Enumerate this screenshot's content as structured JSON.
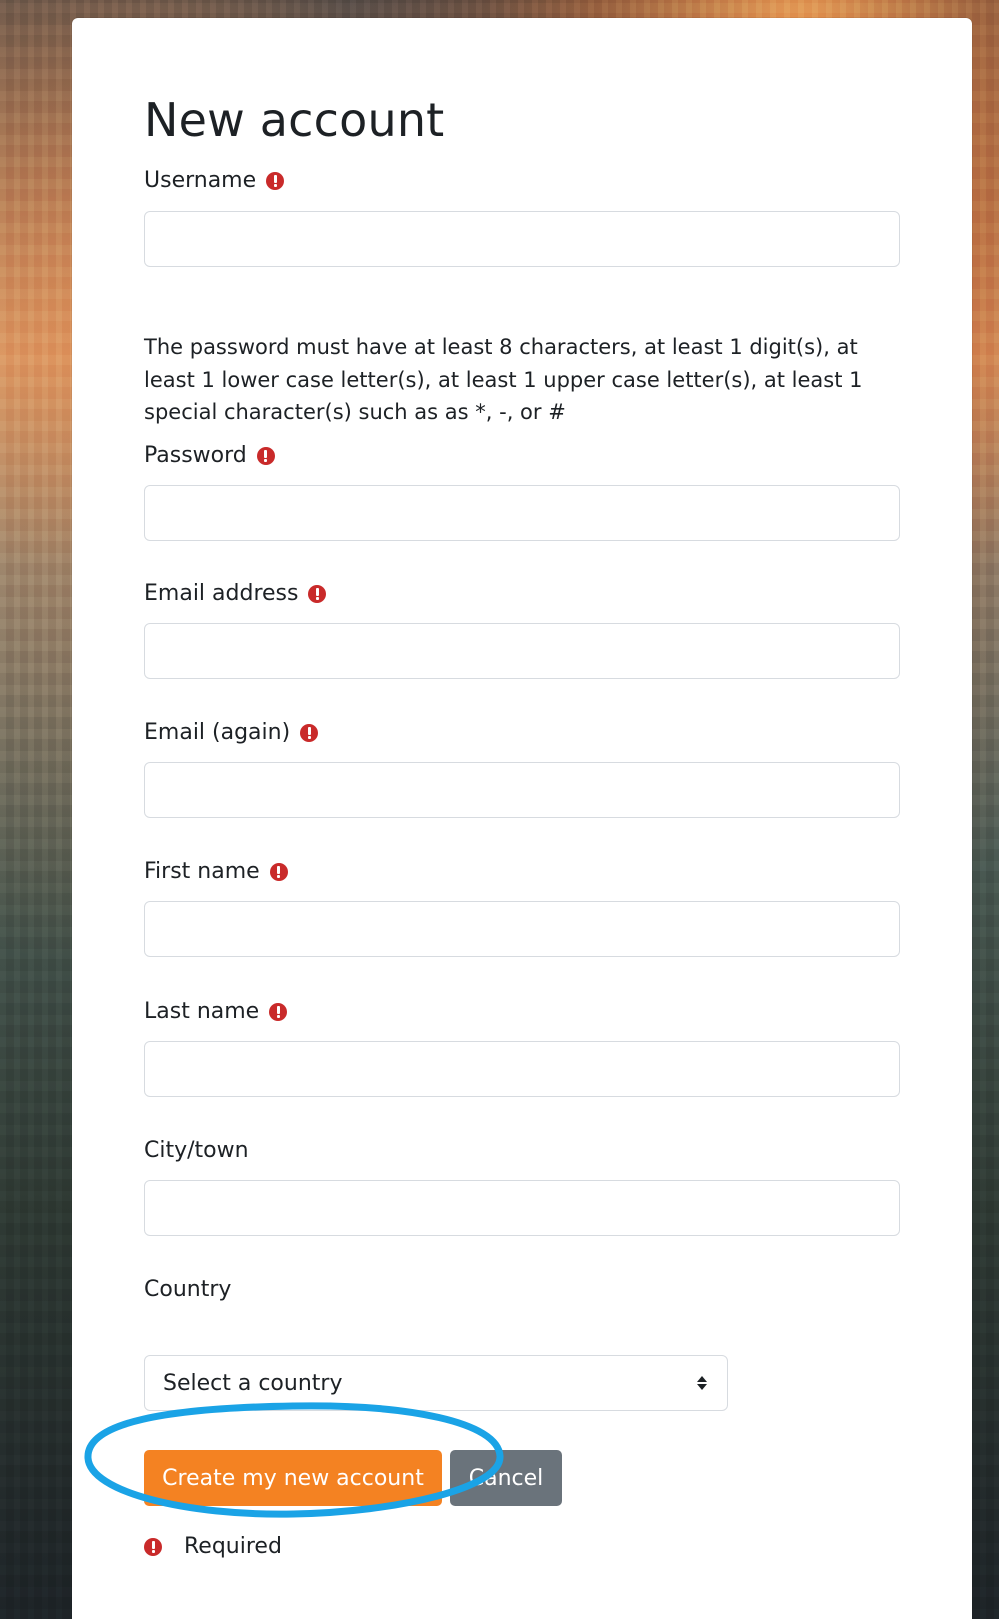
{
  "form": {
    "title": "New account",
    "fields": {
      "username": {
        "label": "Username",
        "value": ""
      },
      "password": {
        "label": "Password",
        "value": ""
      },
      "email": {
        "label": "Email address",
        "value": ""
      },
      "email_again": {
        "label": "Email (again)",
        "value": ""
      },
      "first_name": {
        "label": "First name",
        "value": ""
      },
      "last_name": {
        "label": "Last name",
        "value": ""
      },
      "city": {
        "label": "City/town",
        "value": ""
      },
      "country": {
        "label": "Country",
        "selected": "Select a country"
      }
    },
    "password_help": "The password must have at least 8 characters, at least 1 digit(s), at least 1 lower case letter(s), at least 1 upper case letter(s), at least 1 special character(s) such as as *, -, or #",
    "buttons": {
      "create": "Create my new account",
      "cancel": "Cancel"
    },
    "required_legend": "Required"
  },
  "colors": {
    "primary_button": "#f48222",
    "secondary_button": "#6a737b",
    "required_icon": "#c92a2a",
    "highlight_annotation": "#1aa3e6"
  },
  "icons": {
    "required": "exclamation-circle-icon",
    "select_caret": "sort-caret-icon"
  }
}
